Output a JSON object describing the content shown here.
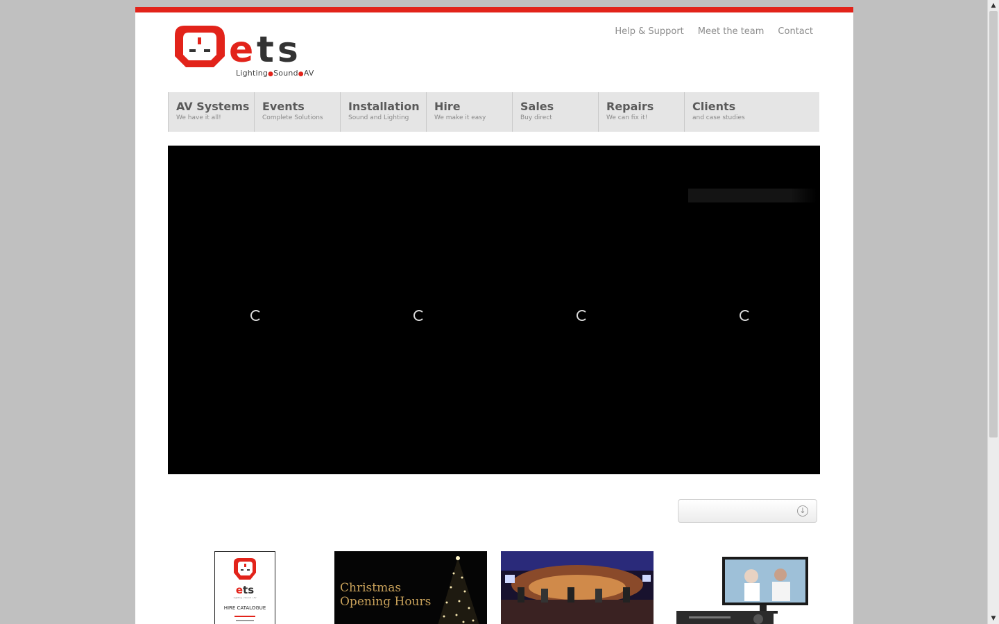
{
  "brand": {
    "name_part1": "e",
    "name_part2": "t",
    "name_part3": "s",
    "tagline_1": "Lighting",
    "tagline_2": "Sound",
    "tagline_3": "AV"
  },
  "top_links": [
    {
      "label": "Help & Support"
    },
    {
      "label": "Meet the team"
    },
    {
      "label": "Contact"
    }
  ],
  "nav": [
    {
      "title": "AV Systems",
      "subtitle": "We have it all!"
    },
    {
      "title": "Events",
      "subtitle": "Complete Solutions"
    },
    {
      "title": "Installation",
      "subtitle": "Sound and Lighting"
    },
    {
      "title": "Hire",
      "subtitle": "We make it easy"
    },
    {
      "title": "Sales",
      "subtitle": "Buy direct"
    },
    {
      "title": "Repairs",
      "subtitle": "We can fix it!"
    },
    {
      "title": "Clients",
      "subtitle": "and case studies"
    }
  ],
  "slider": {
    "loading_spinners": 4,
    "dropdown_icon": "chevron-down-circle-icon"
  },
  "thumbs": {
    "catalogue": {
      "brand_e": "e",
      "brand_ts": "ts",
      "subline": "Lighting • Sound • AV",
      "label": "HIRE CATALOGUE"
    },
    "christmas": {
      "line1": "Christmas",
      "line2": "Opening Hours"
    },
    "event_photo": "conference-panel-photo",
    "product_photo": "monitor-and-dvr-photo"
  },
  "colors": {
    "brand_red": "#e2231a",
    "nav_bg": "#e5e5e5",
    "page_bg": "#c0c0c0"
  }
}
